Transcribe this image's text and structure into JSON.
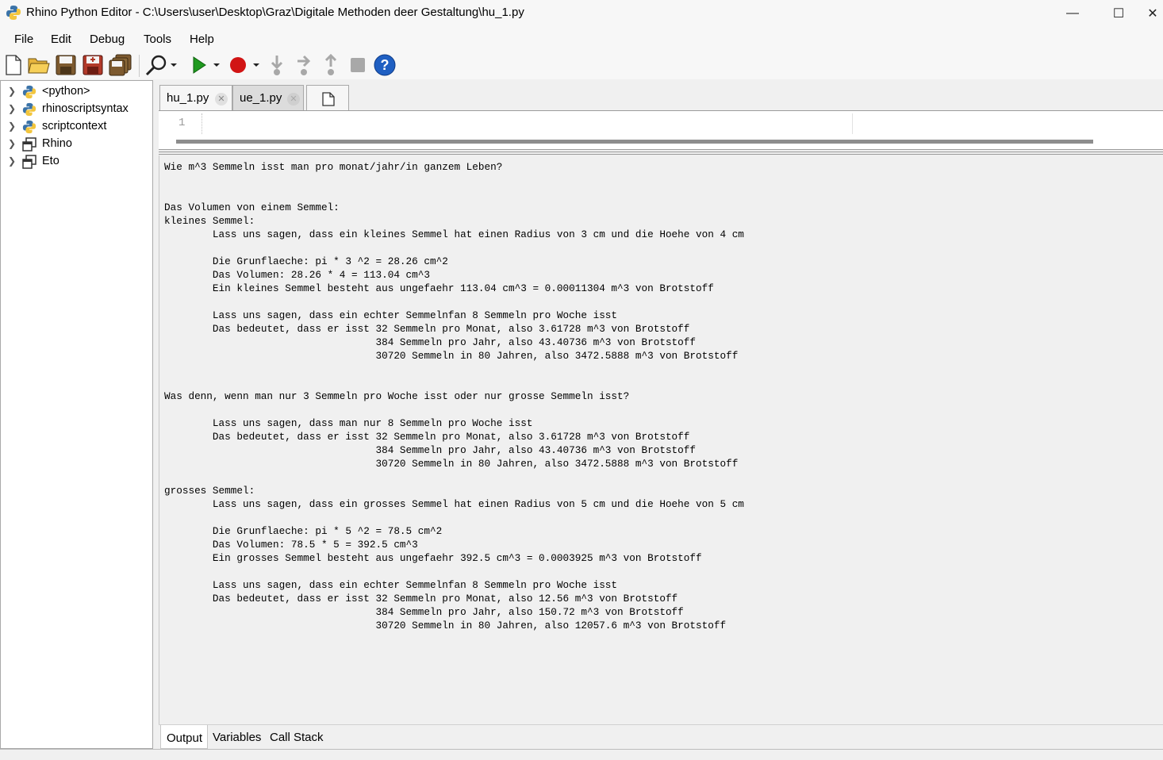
{
  "window": {
    "title": "Rhino Python Editor - C:\\Users\\user\\Desktop\\Graz\\Digitale Methoden deer Gestaltung\\hu_1.py",
    "minimize": "—",
    "maximize": "☐",
    "close": "✕"
  },
  "menu": [
    "File",
    "Edit",
    "Debug",
    "Tools",
    "Help"
  ],
  "toolbar": {
    "icons": [
      "new-file-icon",
      "open-folder-icon",
      "save-icon",
      "save-as-icon",
      "save-all-icon",
      "find-icon",
      "run-icon",
      "breakpoint-icon",
      "step-into-icon",
      "step-over-icon",
      "step-out-icon",
      "stop-icon",
      "help-icon"
    ],
    "colors": {
      "run": "#1f9a1f",
      "breakpoint": "#d11414",
      "help": "#1f5fc2",
      "disabled": "#a8a8a8"
    }
  },
  "tree": {
    "items": [
      {
        "label": "<python>",
        "icon": "python-icon"
      },
      {
        "label": "rhinoscriptsyntax",
        "icon": "python-icon"
      },
      {
        "label": "scriptcontext",
        "icon": "python-icon"
      },
      {
        "label": "Rhino",
        "icon": "namespace-icon"
      },
      {
        "label": "Eto",
        "icon": "namespace-icon"
      }
    ]
  },
  "tabs": [
    {
      "label": "hu_1.py",
      "active": true
    },
    {
      "label": "ue_1.py",
      "active": false
    }
  ],
  "editor": {
    "line_number": "1",
    "code": ""
  },
  "output": {
    "text": "Wie m^3 Semmeln isst man pro monat/jahr/in ganzem Leben?\n\n\nDas Volumen von einem Semmel:\nkleines Semmel:\n        Lass uns sagen, dass ein kleines Semmel hat einen Radius von 3 cm und die Hoehe von 4 cm\n\n        Die Grunflaeche: pi * 3 ^2 = 28.26 cm^2\n        Das Volumen: 28.26 * 4 = 113.04 cm^3\n        Ein kleines Semmel besteht aus ungefaehr 113.04 cm^3 = 0.00011304 m^3 von Brotstoff\n\n        Lass uns sagen, dass ein echter Semmelnfan 8 Semmeln pro Woche isst\n        Das bedeutet, dass er isst 32 Semmeln pro Monat, also 3.61728 m^3 von Brotstoff\n                                   384 Semmeln pro Jahr, also 43.40736 m^3 von Brotstoff\n                                   30720 Semmeln in 80 Jahren, also 3472.5888 m^3 von Brotstoff\n\n\nWas denn, wenn man nur 3 Semmeln pro Woche isst oder nur grosse Semmeln isst?\n\n        Lass uns sagen, dass man nur 8 Semmeln pro Woche isst\n        Das bedeutet, dass er isst 32 Semmeln pro Monat, also 3.61728 m^3 von Brotstoff\n                                   384 Semmeln pro Jahr, also 43.40736 m^3 von Brotstoff\n                                   30720 Semmeln in 80 Jahren, also 3472.5888 m^3 von Brotstoff\n\ngrosses Semmel:\n        Lass uns sagen, dass ein grosses Semmel hat einen Radius von 5 cm und die Hoehe von 5 cm\n\n        Die Grunflaeche: pi * 5 ^2 = 78.5 cm^2\n        Das Volumen: 78.5 * 5 = 392.5 cm^3\n        Ein grosses Semmel besteht aus ungefaehr 392.5 cm^3 = 0.0003925 m^3 von Brotstoff\n\n        Lass uns sagen, dass ein echter Semmelnfan 8 Semmeln pro Woche isst\n        Das bedeutet, dass er isst 32 Semmeln pro Monat, also 12.56 m^3 von Brotstoff\n                                   384 Semmeln pro Jahr, also 150.72 m^3 von Brotstoff\n                                   30720 Semmeln in 80 Jahren, also 12057.6 m^3 von Brotstoff"
  },
  "bottom_tabs": [
    "Output",
    "Variables",
    "Call Stack"
  ]
}
